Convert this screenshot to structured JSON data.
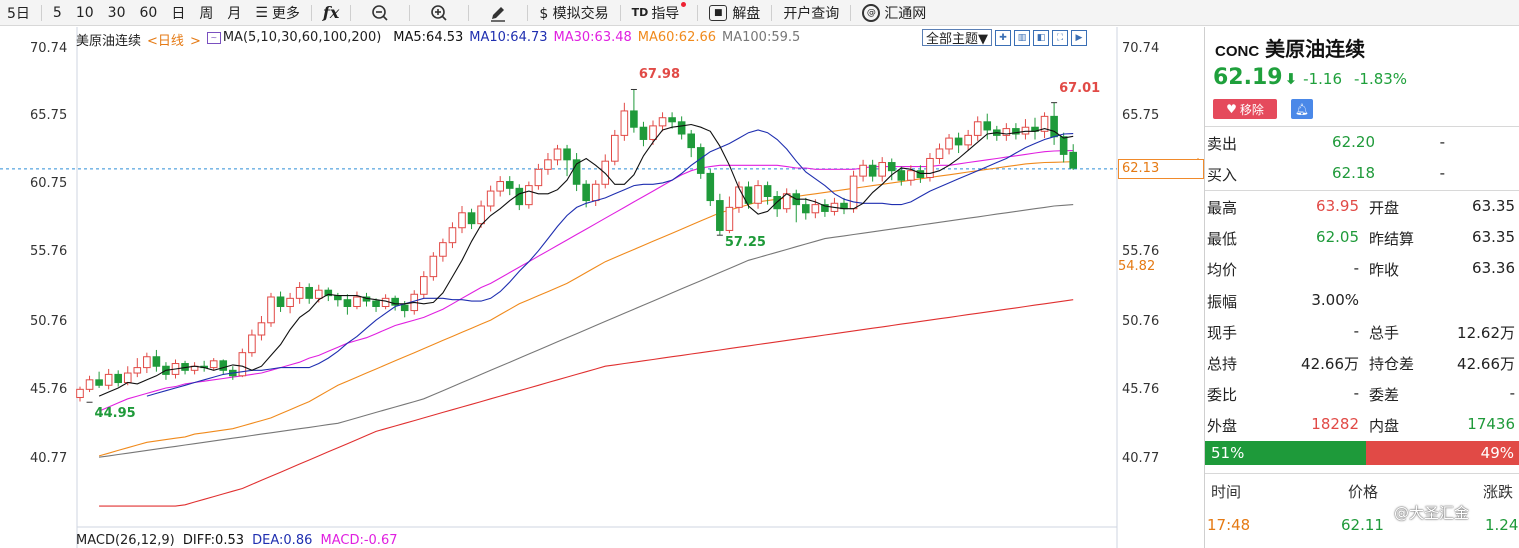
{
  "toolbar": {
    "items": [
      "5日",
      "5",
      "10",
      "30",
      "60",
      "日",
      "周",
      "月",
      "更多",
      "fx",
      "",
      "",
      "",
      "模拟交易",
      "指导",
      "解盘",
      "开户查询",
      "汇通网"
    ],
    "more_icon": "list-icon",
    "zoom_out_icon": "zoom-out-icon",
    "zoom_in_icon": "zoom-in-icon",
    "draw_icon": "pen-icon",
    "dollar_label": "$ 模拟交易",
    "td_label": "TD",
    "td_text": "指导",
    "jiepan": "解盘",
    "kaihu": "开户查询",
    "huitong": "汇通网"
  },
  "legend": {
    "name": "美原油连续",
    "period": "日线",
    "ma_group": "MA(5,10,30,60,100,200)",
    "ma5": "MA5:64.53",
    "ma10": "MA10:64.73",
    "ma30": "MA30:63.48",
    "ma60": "MA60:62.66",
    "ma100": "MA100:59.5",
    "theme": "全部主题▼"
  },
  "colors": {
    "up": "#e14a46",
    "down": "#1f9a3a",
    "ma5": "#111111",
    "ma10": "#1f2fb0",
    "ma30": "#e020e0",
    "ma60": "#f08a1c",
    "ma100": "#777777",
    "ma200": "#e03030",
    "current_line": "#2f8fd8"
  },
  "axis": {
    "left": [
      "70.74",
      "65.75",
      "60.75",
      "55.76",
      "50.76",
      "45.76",
      "40.77"
    ],
    "right": [
      "70.74",
      "65.75",
      "55.76",
      "50.76",
      "45.76",
      "40.77"
    ],
    "current_price": "62.13",
    "ma_price": "54.82"
  },
  "chart_data": {
    "type": "candlestick",
    "ylim": [
      40.77,
      70.74
    ],
    "max_label": "67.98",
    "min_label": "44.95",
    "mid_low_label": "57.25",
    "recent_high_label": "67.01",
    "current_price": 62.13,
    "current_price_label": "62.13",
    "ma60_tag_value": 54.82,
    "ma60_tag_label": "54.82",
    "candles": [
      [
        45.3,
        45.9,
        45.0,
        46.1
      ],
      [
        45.9,
        46.6,
        45.7,
        46.9
      ],
      [
        46.6,
        46.2,
        46.0,
        47.2
      ],
      [
        46.2,
        47.0,
        45.9,
        47.4
      ],
      [
        47.0,
        46.4,
        46.1,
        47.3
      ],
      [
        46.4,
        47.1,
        46.2,
        47.6
      ],
      [
        47.1,
        47.5,
        46.8,
        48.2
      ],
      [
        47.5,
        48.3,
        47.1,
        48.6
      ],
      [
        48.3,
        47.6,
        47.2,
        48.8
      ],
      [
        47.6,
        47.0,
        46.6,
        47.9
      ],
      [
        47.0,
        47.8,
        46.7,
        48.1
      ],
      [
        47.8,
        47.3,
        47.0,
        48.0
      ],
      [
        47.3,
        47.6,
        47.0,
        47.9
      ],
      [
        47.6,
        47.5,
        47.2,
        48.0
      ],
      [
        47.5,
        48.0,
        47.3,
        48.2
      ],
      [
        48.0,
        47.3,
        47.0,
        48.1
      ],
      [
        47.3,
        46.9,
        46.6,
        47.6
      ],
      [
        46.9,
        48.6,
        46.8,
        48.9
      ],
      [
        48.6,
        49.9,
        48.3,
        50.3
      ],
      [
        49.9,
        50.8,
        49.5,
        51.3
      ],
      [
        50.8,
        52.7,
        50.5,
        53.0
      ],
      [
        52.7,
        52.0,
        51.6,
        53.1
      ],
      [
        52.0,
        52.6,
        51.5,
        53.0
      ],
      [
        52.6,
        53.4,
        52.2,
        53.8
      ],
      [
        53.4,
        52.6,
        52.2,
        53.7
      ],
      [
        52.6,
        53.2,
        52.3,
        53.6
      ],
      [
        53.2,
        52.8,
        52.4,
        53.4
      ],
      [
        52.8,
        52.5,
        52.0,
        53.0
      ],
      [
        52.5,
        52.0,
        51.4,
        52.9
      ],
      [
        52.0,
        52.7,
        51.8,
        53.1
      ],
      [
        52.7,
        52.4,
        52.0,
        53.0
      ],
      [
        52.4,
        52.0,
        51.6,
        52.6
      ],
      [
        52.0,
        52.6,
        51.8,
        52.9
      ],
      [
        52.6,
        52.1,
        51.7,
        52.8
      ],
      [
        52.1,
        51.7,
        51.2,
        52.4
      ],
      [
        51.7,
        52.9,
        51.4,
        53.2
      ],
      [
        52.9,
        54.2,
        52.6,
        54.6
      ],
      [
        54.2,
        55.7,
        53.9,
        56.0
      ],
      [
        55.7,
        56.7,
        55.3,
        57.0
      ],
      [
        56.7,
        57.8,
        56.3,
        58.2
      ],
      [
        57.8,
        58.9,
        57.4,
        59.4
      ],
      [
        58.9,
        58.1,
        57.7,
        59.2
      ],
      [
        58.1,
        59.4,
        57.8,
        59.8
      ],
      [
        59.4,
        60.5,
        59.0,
        60.9
      ],
      [
        60.5,
        61.2,
        60.1,
        61.6
      ],
      [
        61.2,
        60.7,
        60.2,
        61.6
      ],
      [
        60.7,
        59.5,
        59.1,
        61.0
      ],
      [
        59.5,
        60.9,
        59.2,
        61.2
      ],
      [
        60.9,
        62.1,
        60.6,
        62.5
      ],
      [
        62.1,
        62.8,
        61.7,
        63.3
      ],
      [
        62.8,
        63.6,
        62.4,
        63.9
      ],
      [
        63.6,
        62.8,
        61.6,
        63.9
      ],
      [
        62.8,
        61.0,
        60.5,
        63.3
      ],
      [
        61.0,
        59.8,
        59.3,
        61.3
      ],
      [
        59.8,
        61.0,
        59.4,
        61.3
      ],
      [
        61.0,
        62.7,
        60.7,
        63.2
      ],
      [
        62.7,
        64.6,
        62.4,
        65.0
      ],
      [
        64.6,
        66.4,
        64.2,
        67.0
      ],
      [
        66.4,
        65.2,
        64.8,
        67.98
      ],
      [
        65.2,
        64.3,
        63.8,
        65.6
      ],
      [
        64.3,
        65.3,
        63.9,
        65.7
      ],
      [
        65.3,
        65.9,
        64.9,
        66.3
      ],
      [
        65.9,
        65.6,
        65.1,
        66.3
      ],
      [
        65.6,
        64.7,
        64.3,
        66.0
      ],
      [
        64.7,
        63.7,
        63.0,
        65.0
      ],
      [
        63.7,
        61.8,
        61.4,
        64.0
      ],
      [
        61.8,
        59.8,
        59.4,
        62.1
      ],
      [
        59.8,
        57.6,
        57.25,
        60.3
      ],
      [
        57.6,
        59.3,
        57.4,
        60.1
      ],
      [
        59.3,
        60.8,
        58.9,
        61.2
      ],
      [
        60.8,
        59.6,
        59.2,
        61.2
      ],
      [
        59.6,
        60.9,
        59.2,
        61.3
      ],
      [
        60.9,
        60.1,
        59.5,
        61.2
      ],
      [
        60.1,
        59.2,
        58.6,
        60.5
      ],
      [
        59.2,
        60.3,
        58.9,
        60.7
      ],
      [
        60.3,
        59.5,
        58.2,
        60.6
      ],
      [
        59.5,
        58.9,
        58.4,
        60.0
      ],
      [
        58.9,
        59.5,
        58.5,
        59.9
      ],
      [
        59.5,
        59.0,
        58.6,
        59.9
      ],
      [
        59.0,
        59.6,
        58.7,
        60.0
      ],
      [
        59.6,
        59.2,
        58.8,
        60.0
      ],
      [
        59.2,
        61.6,
        58.9,
        62.0
      ],
      [
        61.6,
        62.4,
        61.2,
        62.8
      ],
      [
        62.4,
        61.6,
        61.2,
        62.8
      ],
      [
        61.6,
        62.6,
        61.2,
        63.0
      ],
      [
        62.6,
        62.0,
        61.3,
        62.9
      ],
      [
        62.0,
        61.3,
        60.9,
        62.3
      ],
      [
        61.3,
        62.0,
        60.9,
        62.4
      ],
      [
        62.0,
        61.5,
        61.1,
        62.4
      ],
      [
        61.5,
        62.9,
        61.2,
        63.3
      ],
      [
        62.9,
        63.6,
        62.5,
        64.0
      ],
      [
        63.6,
        64.4,
        63.2,
        64.7
      ],
      [
        64.4,
        63.9,
        63.3,
        64.8
      ],
      [
        63.9,
        64.6,
        63.5,
        65.0
      ],
      [
        64.6,
        65.6,
        64.2,
        66.0
      ],
      [
        65.6,
        65.0,
        64.3,
        66.2
      ],
      [
        65.0,
        64.6,
        64.2,
        65.3
      ],
      [
        64.6,
        65.1,
        64.2,
        65.5
      ],
      [
        65.1,
        64.7,
        64.3,
        65.5
      ],
      [
        64.7,
        65.2,
        64.3,
        65.8
      ],
      [
        65.2,
        64.9,
        64.3,
        65.9
      ],
      [
        64.9,
        66.0,
        64.4,
        66.3
      ],
      [
        66.0,
        64.5,
        63.9,
        67.01
      ],
      [
        64.5,
        63.2,
        62.6,
        64.8
      ],
      [
        63.35,
        62.19,
        62.05,
        63.95
      ]
    ],
    "ma5": [
      45.4,
      45.7,
      46.0,
      46.4,
      46.3,
      46.6,
      46.9,
      47.3,
      47.4,
      47.5,
      47.6,
      47.5,
      47.3,
      47.5,
      47.7,
      47.6,
      47.3,
      47.6,
      48.4,
      49.2,
      50.3,
      51.2,
      51.7,
      52.5,
      52.9,
      52.8,
      52.8,
      52.8,
      52.6,
      52.5,
      52.4,
      52.2,
      52.2,
      52.3,
      52.2,
      52.3,
      53.0,
      54.2,
      55.4,
      56.8,
      58.0,
      58.7,
      59.2,
      59.8,
      60.3,
      60.5,
      60.3,
      60.3,
      60.6,
      61.3,
      62.5,
      62.9,
      62.4,
      61.8,
      61.0,
      61.0,
      61.7,
      63.1,
      64.1,
      65.0,
      65.2,
      65.3,
      65.4,
      65.2,
      64.9,
      63.8,
      62.4,
      60.7,
      59.4,
      58.8,
      59.0,
      59.7,
      60.3,
      59.9,
      59.9,
      59.7,
      59.4,
      59.3,
      59.2,
      59.2,
      59.6,
      60.4,
      61.0,
      61.7,
      62.2,
      62.1,
      61.8,
      61.8,
      62.0,
      62.4,
      62.9,
      63.5,
      64.1,
      64.7,
      64.8,
      64.7,
      64.8,
      64.9,
      64.9,
      65.1,
      64.9,
      64.4,
      64.53
    ],
    "ma10": [
      45.4,
      45.6,
      45.8,
      46.0,
      46.2,
      46.4,
      46.6,
      46.8,
      47.0,
      47.1,
      47.2,
      47.3,
      47.3,
      47.4,
      47.5,
      47.5,
      47.5,
      47.5,
      47.8,
      48.2,
      48.7,
      49.3,
      49.8,
      50.4,
      51.0,
      51.5,
      52.0,
      52.2,
      52.4,
      52.6,
      52.6,
      52.6,
      52.5,
      52.5,
      52.4,
      52.4,
      52.6,
      53.1,
      53.8,
      54.6,
      55.3,
      56.1,
      57.0,
      57.9,
      58.7,
      59.3,
      59.6,
      59.8,
      60.0,
      60.3,
      60.6,
      60.9,
      61.0,
      61.0,
      61.1,
      61.3,
      61.8,
      62.4,
      62.9,
      63.4,
      63.7,
      64.0,
      64.4,
      64.8,
      65.0,
      64.8,
      64.3,
      63.6,
      62.7,
      61.9,
      61.4,
      60.9,
      60.3,
      59.9,
      59.7,
      59.6,
      59.6,
      59.6,
      59.5,
      59.5,
      59.7,
      60.1,
      60.5,
      60.8,
      61.1,
      61.4,
      61.7,
      62.0,
      62.3,
      62.6,
      62.9,
      63.3,
      63.7,
      64.0,
      64.3,
      64.5,
      64.7,
      64.73
    ],
    "ma30": [
      44.3,
      44.6,
      44.9,
      45.2,
      45.4,
      45.6,
      45.8,
      46.0,
      46.1,
      46.3,
      46.4,
      46.5,
      46.6,
      46.7,
      46.8,
      46.9,
      47.0,
      47.1,
      47.3,
      47.5,
      47.7,
      47.9,
      48.2,
      48.4,
      48.7,
      49.0,
      49.3,
      49.5,
      49.7,
      50.0,
      50.3,
      50.6,
      50.8,
      51.0,
      51.2,
      51.5,
      51.8,
      52.2,
      52.6,
      53.0,
      53.4,
      53.7,
      54.1,
      54.5,
      54.9,
      55.3,
      55.7,
      56.1,
      56.5,
      56.9,
      57.3,
      57.7,
      58.1,
      58.5,
      58.9,
      59.3,
      59.7,
      60.1,
      60.5,
      60.9,
      61.3,
      61.7,
      62.0,
      62.2,
      62.3,
      62.4,
      62.4,
      62.4,
      62.4,
      62.4,
      62.4,
      62.4,
      62.3,
      62.2,
      62.2,
      62.1,
      62.1,
      62.1,
      62.1,
      62.1,
      62.2,
      62.3,
      62.3,
      62.3,
      62.3,
      62.3,
      62.3,
      62.3,
      62.4,
      62.4,
      62.5,
      62.6,
      62.7,
      62.8,
      62.9,
      63.0,
      63.1,
      63.2,
      63.3,
      63.4,
      63.45,
      63.47,
      63.48
    ],
    "ma60": [
      41.0,
      41.2,
      41.4,
      41.6,
      41.8,
      42.0,
      42.1,
      42.2,
      42.3,
      42.4,
      42.6,
      42.7,
      42.8,
      42.9,
      43.0,
      43.2,
      43.4,
      43.6,
      43.8,
      44.1,
      44.4,
      44.7,
      45.0,
      45.4,
      45.8,
      46.2,
      46.5,
      46.8,
      47.1,
      47.4,
      47.7,
      48.0,
      48.3,
      48.6,
      48.9,
      49.2,
      49.5,
      49.8,
      50.1,
      50.4,
      50.7,
      51.0,
      51.4,
      51.8,
      52.2,
      52.5,
      52.8,
      53.1,
      53.4,
      53.7,
      54.1,
      54.5,
      54.9,
      55.3,
      55.6,
      55.9,
      56.2,
      56.5,
      56.8,
      57.1,
      57.4,
      57.7,
      58.0,
      58.3,
      58.6,
      58.9,
      59.1,
      59.3,
      59.5,
      59.7,
      59.8,
      59.9,
      60.0,
      60.1,
      60.2,
      60.3,
      60.4,
      60.5,
      60.6,
      60.7,
      60.8,
      60.9,
      61.0,
      61.1,
      61.2,
      61.3,
      61.4,
      61.5,
      61.6,
      61.7,
      61.8,
      61.9,
      62.0,
      62.1,
      62.2,
      62.3,
      62.4,
      62.5,
      62.55,
      62.6,
      62.62,
      62.64,
      62.66
    ],
    "ma100": [
      40.9,
      41.0,
      41.1,
      41.2,
      41.3,
      41.4,
      41.5,
      41.6,
      41.7,
      41.8,
      41.9,
      42.0,
      42.1,
      42.2,
      42.3,
      42.4,
      42.5,
      42.6,
      42.7,
      42.8,
      42.9,
      43.0,
      43.1,
      43.2,
      43.3,
      43.4,
      43.6,
      43.8,
      44.0,
      44.2,
      44.4,
      44.6,
      44.8,
      45.0,
      45.2,
      45.5,
      45.8,
      46.1,
      46.4,
      46.7,
      47.0,
      47.3,
      47.6,
      47.9,
      48.2,
      48.5,
      48.8,
      49.1,
      49.4,
      49.7,
      50.0,
      50.3,
      50.6,
      50.9,
      51.2,
      51.5,
      51.8,
      52.1,
      52.4,
      52.7,
      53.0,
      53.3,
      53.6,
      53.9,
      54.2,
      54.5,
      54.8,
      55.1,
      55.4,
      55.6,
      55.8,
      56.0,
      56.2,
      56.4,
      56.6,
      56.8,
      57.0,
      57.1,
      57.2,
      57.3,
      57.4,
      57.5,
      57.6,
      57.7,
      57.8,
      57.9,
      58.0,
      58.1,
      58.2,
      58.3,
      58.4,
      58.5,
      58.6,
      58.7,
      58.8,
      58.9,
      59.0,
      59.1,
      59.2,
      59.3,
      59.4,
      59.45,
      59.5
    ],
    "ma200": [
      37.3,
      37.3,
      37.3,
      37.3,
      37.3,
      37.3,
      37.3,
      37.3,
      37.3,
      37.4,
      37.6,
      37.8,
      38.0,
      38.2,
      38.4,
      38.6,
      38.9,
      39.2,
      39.5,
      39.8,
      40.1,
      40.4,
      40.7,
      41.0,
      41.3,
      41.6,
      41.9,
      42.2,
      42.5,
      42.8,
      43.0,
      43.2,
      43.4,
      43.6,
      43.8,
      44.0,
      44.2,
      44.4,
      44.6,
      44.8,
      45.0,
      45.2,
      45.4,
      45.6,
      45.8,
      46.0,
      46.2,
      46.4,
      46.6,
      46.8,
      47.0,
      47.2,
      47.4,
      47.6,
      47.7,
      47.8,
      47.9,
      48.0,
      48.1,
      48.2,
      48.3,
      48.4,
      48.5,
      48.6,
      48.7,
      48.8,
      48.9,
      49.0,
      49.1,
      49.2,
      49.3,
      49.4,
      49.5,
      49.6,
      49.7,
      49.8,
      49.9,
      50.0,
      50.1,
      50.2,
      50.3,
      50.4,
      50.5,
      50.6,
      50.7,
      50.8,
      50.9,
      51.0,
      51.1,
      51.2,
      51.3,
      51.4,
      51.5,
      51.6,
      51.7,
      51.8,
      51.9,
      52.0,
      52.1,
      52.2,
      52.3,
      52.4,
      52.5
    ]
  },
  "macd": {
    "label": "MACD(26,12,9)",
    "diff": "DIFF:0.53",
    "dea": "DEA:0.86",
    "macd": "MACD:-0.67"
  },
  "panel": {
    "code": "CONC",
    "name": "美原油连续",
    "price": "62.19",
    "arrow": "⬇",
    "change": "-1.16",
    "change_pct": "-1.83%",
    "remove_label": "移除",
    "sell_label": "卖出",
    "sell_price": "62.20",
    "sell_vol": "-",
    "buy_label": "买入",
    "buy_price": "62.18",
    "buy_vol": "-",
    "rows": [
      {
        "k1": "最高",
        "v1": "63.95",
        "c1": "#e14a46",
        "k2": "开盘",
        "v2": "63.35",
        "c2": "#222222"
      },
      {
        "k1": "最低",
        "v1": "62.05",
        "c1": "#1f9a3a",
        "k2": "昨结算",
        "v2": "63.35",
        "c2": "#222222"
      },
      {
        "k1": "均价",
        "v1": "-",
        "c1": "#222222",
        "k2": "昨收",
        "v2": "63.36",
        "c2": "#222222"
      },
      {
        "k1": "振幅",
        "v1": "3.00%",
        "c1": "#222222",
        "k2": "",
        "v2": "",
        "c2": "#222222"
      },
      {
        "k1": "现手",
        "v1": "-",
        "c1": "#222222",
        "k2": "总手",
        "v2": "12.62万",
        "c2": "#222222"
      },
      {
        "k1": "总持",
        "v1": "42.66万",
        "c1": "#222222",
        "k2": "持仓差",
        "v2": "42.66万",
        "c2": "#222222"
      },
      {
        "k1": "委比",
        "v1": "-",
        "c1": "#222222",
        "k2": "委差",
        "v2": "-",
        "c2": "#222222"
      },
      {
        "k1": "外盘",
        "v1": "18282",
        "c1": "#e14a46",
        "k2": "内盘",
        "v2": "17436",
        "c2": "#1f9a3a"
      }
    ],
    "bar_left": "51%",
    "bar_right": "49%",
    "bar_left_fraction": 0.51,
    "th_time": "时间",
    "th_price": "价格",
    "th_change": "涨跌",
    "t_time": "17:48",
    "t_price": "62.11",
    "t_change": "1.24",
    "watermark": "@大圣汇金"
  }
}
